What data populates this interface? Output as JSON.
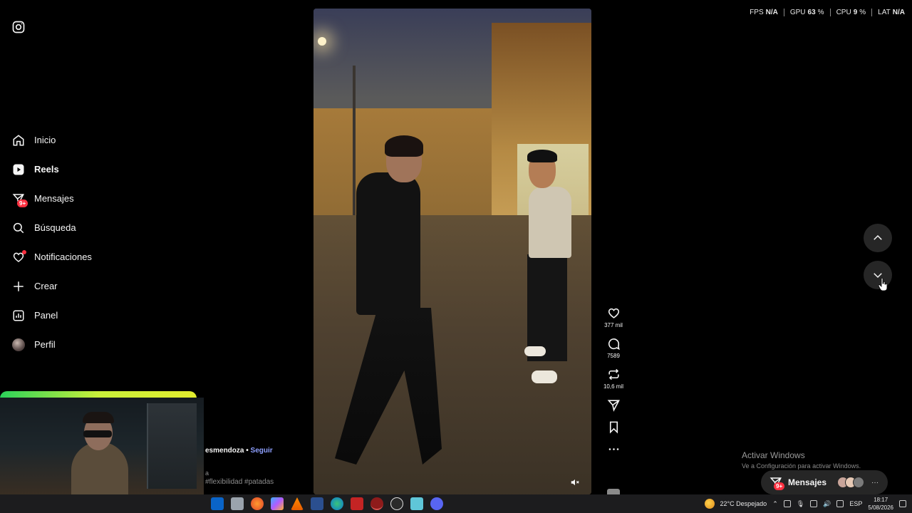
{
  "nav": {
    "items": [
      {
        "label": "Inicio",
        "icon": "home-icon"
      },
      {
        "label": "Reels",
        "icon": "reels-icon"
      },
      {
        "label": "Mensajes",
        "icon": "messages-icon",
        "badge": "9+"
      },
      {
        "label": "Búsqueda",
        "icon": "search-icon"
      },
      {
        "label": "Notificaciones",
        "icon": "heart-icon"
      },
      {
        "label": "Crear",
        "icon": "plus-icon"
      },
      {
        "label": "Panel",
        "icon": "dashboard-icon"
      },
      {
        "label": "Perfil",
        "icon": "avatar"
      }
    ]
  },
  "caption": {
    "user": "esmendoza",
    "separator": "•",
    "follow": "Seguir",
    "fragment": "a",
    "tags": "#flexibilidad #patadas"
  },
  "actions": {
    "likes": "377 mil",
    "comments": "7589",
    "reposts": "10,6 mil"
  },
  "perf": {
    "fps_label": "FPS",
    "fps_value": "N/A",
    "gpu_label": "GPU",
    "gpu_value": "63",
    "cpu_label": "CPU",
    "cpu_value": "9",
    "lat_label": "LAT",
    "lat_value": "N/A",
    "percent": "%"
  },
  "activate": {
    "title": "Activar Windows",
    "subtitle": "Ve a Configuración para activar Windows."
  },
  "messages_pill": {
    "label": "Mensajes",
    "badge": "9+",
    "more": "···"
  },
  "taskbar": {
    "weather": "22°C  Despejado",
    "lang": "ESP",
    "time": "18:17",
    "date": "5/08/2026"
  },
  "colors": {
    "badge": "#ff3040",
    "follow": "#8ea0ff",
    "background": "#000000"
  }
}
